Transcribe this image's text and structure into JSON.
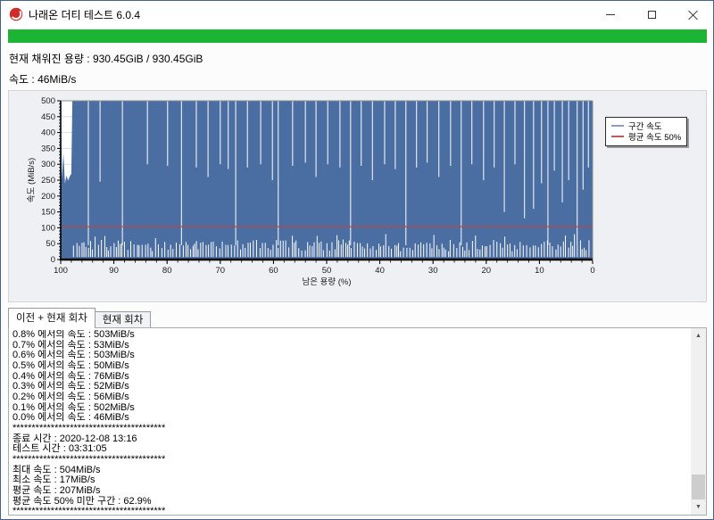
{
  "window": {
    "title": "나래온 더티 테스트 6.0.4",
    "controls": {
      "minimize": "minimize",
      "maximize": "maximize",
      "close": "close"
    }
  },
  "status": {
    "progress_percent": 100,
    "progress_color": "#1cb434",
    "capacity_label": "현재 채워진 용량 : 930.45GiB / 930.45GiB",
    "speed_label": "속도 : 46MiB/s"
  },
  "chart_data": {
    "type": "line",
    "xlabel": "남은 용량 (%)",
    "ylabel": "속도 (MiB/s)",
    "xlim": [
      100,
      0
    ],
    "ylim": [
      0,
      500
    ],
    "x_ticks": [
      100,
      90,
      80,
      70,
      60,
      50,
      40,
      30,
      20,
      10,
      0
    ],
    "y_ticks": [
      0,
      50,
      100,
      150,
      200,
      250,
      300,
      350,
      400,
      450,
      500
    ],
    "grid": "horizontal",
    "legend_position": "right-outside",
    "legend": [
      {
        "label": "구간 속도",
        "color": "#8aa0be"
      },
      {
        "label": "평균 속도 50%",
        "color": "#bf5b5b"
      }
    ],
    "series_color": "#4a6da2",
    "baseline_value": 500,
    "avg50_value": 103.5,
    "avg50_color": "#b84848",
    "start_transient": [
      [
        100,
        500
      ],
      [
        99.8,
        255
      ],
      [
        99.5,
        335
      ],
      [
        99.2,
        240
      ],
      [
        98.9,
        265
      ],
      [
        98.6,
        248
      ],
      [
        98.3,
        262
      ],
      [
        98.0,
        270
      ],
      [
        97.8,
        500
      ]
    ],
    "dips": [
      [
        94.8,
        45
      ],
      [
        92.6,
        245
      ],
      [
        88.4,
        45
      ],
      [
        83.7,
        300
      ],
      [
        79.9,
        295
      ],
      [
        77.3,
        45
      ],
      [
        74.5,
        290
      ],
      [
        72.3,
        260
      ],
      [
        70.0,
        300
      ],
      [
        68.5,
        285
      ],
      [
        67.1,
        45
      ],
      [
        64.9,
        290
      ],
      [
        62.4,
        300
      ],
      [
        60.2,
        250
      ],
      [
        59.1,
        45
      ],
      [
        56.4,
        295
      ],
      [
        54.0,
        305
      ],
      [
        52.0,
        260
      ],
      [
        49.8,
        300
      ],
      [
        47.5,
        290
      ],
      [
        45.5,
        45
      ],
      [
        43.5,
        295
      ],
      [
        41.4,
        250
      ],
      [
        39.1,
        300
      ],
      [
        37.1,
        285
      ],
      [
        35.1,
        45
      ],
      [
        33.1,
        290
      ],
      [
        31.1,
        305
      ],
      [
        28.9,
        260
      ],
      [
        26.7,
        295
      ],
      [
        24.7,
        45
      ],
      [
        22.7,
        300
      ],
      [
        20.5,
        250
      ],
      [
        18.5,
        290
      ],
      [
        16.6,
        150
      ],
      [
        14.6,
        300
      ],
      [
        12.8,
        130
      ],
      [
        11.1,
        160
      ],
      [
        9.6,
        240
      ],
      [
        8.4,
        45
      ],
      [
        7.2,
        280
      ],
      [
        5.7,
        180
      ],
      [
        4.5,
        250
      ],
      [
        2.9,
        45
      ],
      [
        1.8,
        220
      ],
      [
        0.8,
        290
      ]
    ],
    "comb": {
      "x_start": 97.6,
      "x_end": 0.2,
      "step_pct": 0.42,
      "height_min": 18,
      "height_max": 55,
      "base": 8,
      "seed": 7
    }
  },
  "tabs": [
    {
      "label": "이전 + 현재 회차",
      "active": true
    },
    {
      "label": "현재 회차",
      "active": false
    }
  ],
  "log": {
    "lines": [
      "0.8% 에서의 속도 : 503MiB/s",
      "0.7% 에서의 속도 : 53MiB/s",
      "0.6% 에서의 속도 : 503MiB/s",
      "0.5% 에서의 속도 : 50MiB/s",
      "0.4% 에서의 속도 : 76MiB/s",
      "0.3% 에서의 속도 : 52MiB/s",
      "0.2% 에서의 속도 : 56MiB/s",
      "0.1% 에서의 속도 : 502MiB/s",
      "0.0% 에서의 속도 : 46MiB/s",
      "****************************************",
      "종료 시간 : 2020-12-08 13:16",
      "테스트 시간 : 03:31:05",
      "****************************************",
      "최대 속도 : 504MiB/s",
      "최소 속도 : 17MiB/s",
      "평균 속도 : 207MiB/s",
      "평균 속도 50% 미만 구간 : 62.9%",
      "****************************************"
    ]
  }
}
